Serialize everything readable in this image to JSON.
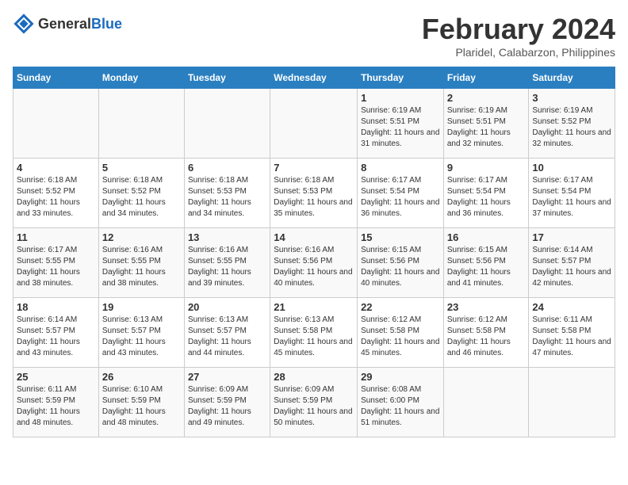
{
  "header": {
    "logo_general": "General",
    "logo_blue": "Blue",
    "month": "February 2024",
    "location": "Plaridel, Calabarzon, Philippines"
  },
  "days_of_week": [
    "Sunday",
    "Monday",
    "Tuesday",
    "Wednesday",
    "Thursday",
    "Friday",
    "Saturday"
  ],
  "weeks": [
    [
      {
        "day": "",
        "info": ""
      },
      {
        "day": "",
        "info": ""
      },
      {
        "day": "",
        "info": ""
      },
      {
        "day": "",
        "info": ""
      },
      {
        "day": "1",
        "info": "Sunrise: 6:19 AM\nSunset: 5:51 PM\nDaylight: 11 hours and 31 minutes."
      },
      {
        "day": "2",
        "info": "Sunrise: 6:19 AM\nSunset: 5:51 PM\nDaylight: 11 hours and 32 minutes."
      },
      {
        "day": "3",
        "info": "Sunrise: 6:19 AM\nSunset: 5:52 PM\nDaylight: 11 hours and 32 minutes."
      }
    ],
    [
      {
        "day": "4",
        "info": "Sunrise: 6:18 AM\nSunset: 5:52 PM\nDaylight: 11 hours and 33 minutes."
      },
      {
        "day": "5",
        "info": "Sunrise: 6:18 AM\nSunset: 5:52 PM\nDaylight: 11 hours and 34 minutes."
      },
      {
        "day": "6",
        "info": "Sunrise: 6:18 AM\nSunset: 5:53 PM\nDaylight: 11 hours and 34 minutes."
      },
      {
        "day": "7",
        "info": "Sunrise: 6:18 AM\nSunset: 5:53 PM\nDaylight: 11 hours and 35 minutes."
      },
      {
        "day": "8",
        "info": "Sunrise: 6:17 AM\nSunset: 5:54 PM\nDaylight: 11 hours and 36 minutes."
      },
      {
        "day": "9",
        "info": "Sunrise: 6:17 AM\nSunset: 5:54 PM\nDaylight: 11 hours and 36 minutes."
      },
      {
        "day": "10",
        "info": "Sunrise: 6:17 AM\nSunset: 5:54 PM\nDaylight: 11 hours and 37 minutes."
      }
    ],
    [
      {
        "day": "11",
        "info": "Sunrise: 6:17 AM\nSunset: 5:55 PM\nDaylight: 11 hours and 38 minutes."
      },
      {
        "day": "12",
        "info": "Sunrise: 6:16 AM\nSunset: 5:55 PM\nDaylight: 11 hours and 38 minutes."
      },
      {
        "day": "13",
        "info": "Sunrise: 6:16 AM\nSunset: 5:55 PM\nDaylight: 11 hours and 39 minutes."
      },
      {
        "day": "14",
        "info": "Sunrise: 6:16 AM\nSunset: 5:56 PM\nDaylight: 11 hours and 40 minutes."
      },
      {
        "day": "15",
        "info": "Sunrise: 6:15 AM\nSunset: 5:56 PM\nDaylight: 11 hours and 40 minutes."
      },
      {
        "day": "16",
        "info": "Sunrise: 6:15 AM\nSunset: 5:56 PM\nDaylight: 11 hours and 41 minutes."
      },
      {
        "day": "17",
        "info": "Sunrise: 6:14 AM\nSunset: 5:57 PM\nDaylight: 11 hours and 42 minutes."
      }
    ],
    [
      {
        "day": "18",
        "info": "Sunrise: 6:14 AM\nSunset: 5:57 PM\nDaylight: 11 hours and 43 minutes."
      },
      {
        "day": "19",
        "info": "Sunrise: 6:13 AM\nSunset: 5:57 PM\nDaylight: 11 hours and 43 minutes."
      },
      {
        "day": "20",
        "info": "Sunrise: 6:13 AM\nSunset: 5:57 PM\nDaylight: 11 hours and 44 minutes."
      },
      {
        "day": "21",
        "info": "Sunrise: 6:13 AM\nSunset: 5:58 PM\nDaylight: 11 hours and 45 minutes."
      },
      {
        "day": "22",
        "info": "Sunrise: 6:12 AM\nSunset: 5:58 PM\nDaylight: 11 hours and 45 minutes."
      },
      {
        "day": "23",
        "info": "Sunrise: 6:12 AM\nSunset: 5:58 PM\nDaylight: 11 hours and 46 minutes."
      },
      {
        "day": "24",
        "info": "Sunrise: 6:11 AM\nSunset: 5:58 PM\nDaylight: 11 hours and 47 minutes."
      }
    ],
    [
      {
        "day": "25",
        "info": "Sunrise: 6:11 AM\nSunset: 5:59 PM\nDaylight: 11 hours and 48 minutes."
      },
      {
        "day": "26",
        "info": "Sunrise: 6:10 AM\nSunset: 5:59 PM\nDaylight: 11 hours and 48 minutes."
      },
      {
        "day": "27",
        "info": "Sunrise: 6:09 AM\nSunset: 5:59 PM\nDaylight: 11 hours and 49 minutes."
      },
      {
        "day": "28",
        "info": "Sunrise: 6:09 AM\nSunset: 5:59 PM\nDaylight: 11 hours and 50 minutes."
      },
      {
        "day": "29",
        "info": "Sunrise: 6:08 AM\nSunset: 6:00 PM\nDaylight: 11 hours and 51 minutes."
      },
      {
        "day": "",
        "info": ""
      },
      {
        "day": "",
        "info": ""
      }
    ]
  ]
}
